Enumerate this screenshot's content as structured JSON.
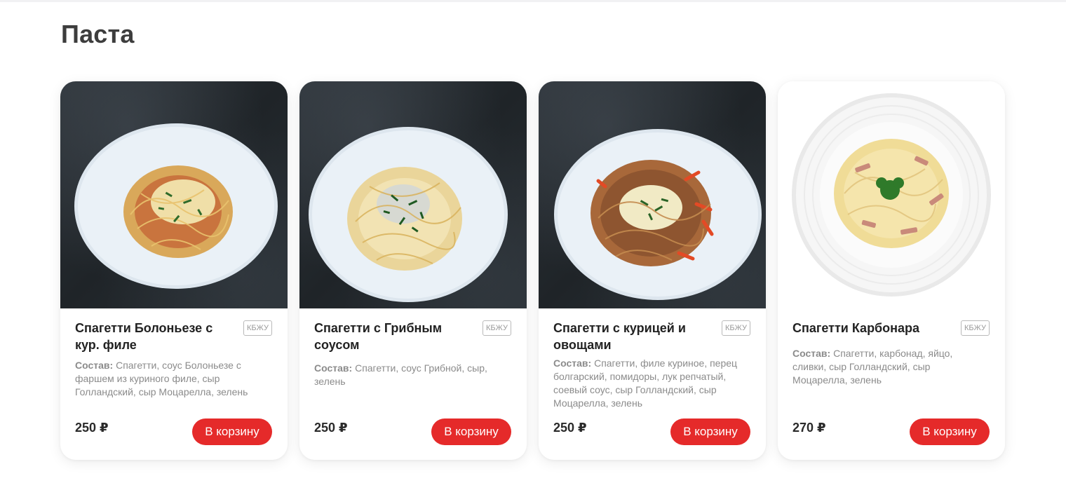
{
  "section": {
    "title": "Паста"
  },
  "labels": {
    "composition": "Состав:",
    "kbju": "КБЖУ",
    "add_to_cart": "В корзину"
  },
  "products": [
    {
      "name": "Спагетти Болоньезе с кур. филе",
      "composition": "Спагетти, соус Болоньезе с фаршем из куриного филе, сыр Голландский, сыр Моцарелла, зелень",
      "price": "250 ₽"
    },
    {
      "name": "Спагетти с Грибным соусом",
      "composition": "Спагетти, соус Грибной, сыр, зелень",
      "price": "250 ₽"
    },
    {
      "name": "Спагетти с курицей и овощами",
      "composition": "Спагетти, филе куриное, перец болгарский, помидоры, лук репчатый, соевый соус, сыр Голландский, сыр Моцарелла, зелень",
      "price": "250 ₽"
    },
    {
      "name": "Спагетти Карбонара",
      "composition": "Спагетти, карбонад, яйцо, сливки, сыр Голландский, сыр Моцарелла, зелень",
      "price": "270 ₽"
    }
  ],
  "colors": {
    "accent": "#e52a2a",
    "title": "#3d3d3d",
    "muted": "#8b8b8b"
  }
}
